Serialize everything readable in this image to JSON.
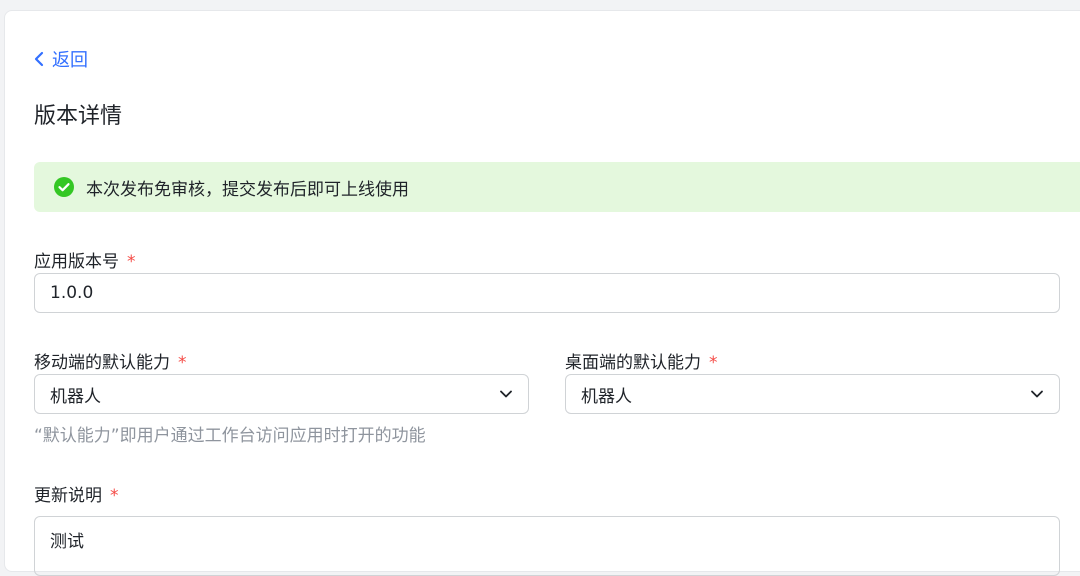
{
  "nav": {
    "back_label": "返回"
  },
  "page": {
    "title": "版本详情"
  },
  "alert": {
    "text": "本次发布免审核，提交发布后即可上线使用",
    "status_color": "#34c724"
  },
  "version": {
    "label": "应用版本号",
    "required_mark": "*",
    "value": "1.0.0"
  },
  "mobile_default": {
    "label": "移动端的默认能力",
    "required_mark": "*",
    "value": "机器人"
  },
  "desktop_default": {
    "label": "桌面端的默认能力",
    "required_mark": "*",
    "value": "机器人"
  },
  "default_hint": "“默认能力”即用户通过工作台访问应用时打开的功能",
  "release_notes": {
    "label": "更新说明",
    "required_mark": "*",
    "value": "测试"
  },
  "colors": {
    "accent": "#3370ff",
    "required": "#f54a45",
    "alert_bg": "#e4f8dd"
  }
}
